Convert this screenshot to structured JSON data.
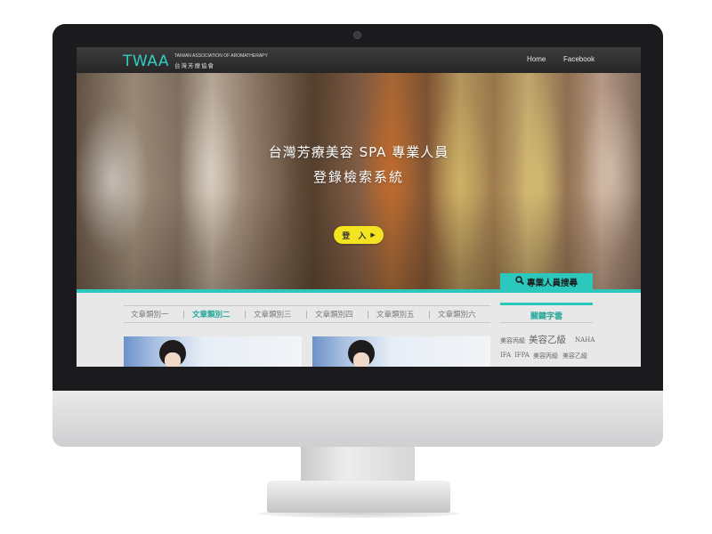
{
  "navbar": {
    "logo_mark": "TWAA",
    "logo_en": "TAIWAN ASSOCIATION OF AROMATHERAPY",
    "logo_zh": "台灣芳療協會",
    "links": [
      "Home",
      "Facebook"
    ]
  },
  "hero": {
    "title_line1": "台灣芳療美容 SPA 專業人員",
    "title_line2": "登錄檢索系統",
    "login_label": "登 入",
    "login_arrow": "▶"
  },
  "search_tab": {
    "icon": "search-icon",
    "label": "專業人員搜尋"
  },
  "categories": {
    "active_index": 1,
    "items": [
      "文章類別一",
      "文章類別二",
      "文章類別三",
      "文章類別四",
      "文章類別五",
      "文章類別六"
    ]
  },
  "keywords": {
    "title": "關鍵字雲",
    "tags": [
      "美容丙級",
      "美容乙級",
      "NAHA",
      "IFA",
      "IFPA",
      "美容丙級",
      "美容乙級"
    ]
  },
  "colors": {
    "accent": "#2bc8bd",
    "button": "#f4e320",
    "navbar": "#2e2e2e"
  }
}
